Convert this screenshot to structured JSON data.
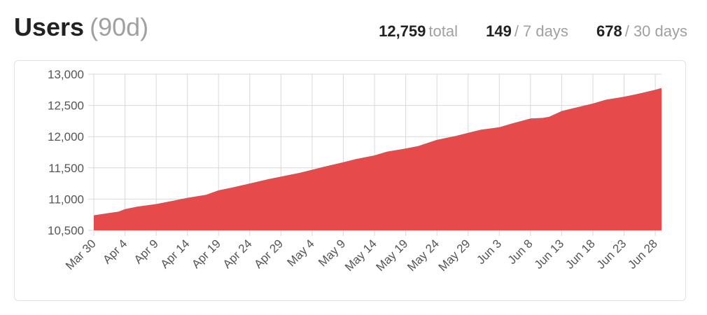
{
  "header": {
    "title": "Users",
    "period": "(90d)",
    "stats": [
      {
        "value": "12,759",
        "label": "total"
      },
      {
        "value": "149",
        "label": "/ 7 days"
      },
      {
        "value": "678",
        "label": "/ 30 days"
      }
    ]
  },
  "colors": {
    "area_fill": "#e64a4a",
    "grid": "#d9d9d9",
    "tick_text": "#555555"
  },
  "chart_data": {
    "type": "area",
    "title": "",
    "xlabel": "",
    "ylabel": "",
    "grid": true,
    "ylim": [
      10500,
      13000
    ],
    "y_ticks": [
      10500,
      11000,
      11500,
      12000,
      12500,
      13000
    ],
    "y_tick_labels": [
      "10,500",
      "11,000",
      "11,500",
      "12,000",
      "12,500",
      "13,000"
    ],
    "x_tick_labels": [
      "Mar 30",
      "Apr 4",
      "Apr 9",
      "Apr 14",
      "Apr 19",
      "Apr 24",
      "Apr 29",
      "May 4",
      "May 9",
      "May 14",
      "May 19",
      "May 24",
      "May 29",
      "Jun 3",
      "Jun 8",
      "Jun 13",
      "Jun 18",
      "Jun 23",
      "Jun 28"
    ],
    "x": [
      "Mar 30",
      "Apr 1",
      "Apr 3",
      "Apr 4",
      "Apr 6",
      "Apr 9",
      "Apr 12",
      "Apr 14",
      "Apr 17",
      "Apr 19",
      "Apr 21",
      "Apr 24",
      "Apr 27",
      "Apr 29",
      "May 2",
      "May 4",
      "May 6",
      "May 9",
      "May 11",
      "May 14",
      "May 16",
      "May 19",
      "May 21",
      "May 24",
      "May 27",
      "May 29",
      "May 31",
      "Jun 3",
      "Jun 5",
      "Jun 8",
      "Jun 10",
      "Jun 11",
      "Jun 13",
      "Jun 15",
      "Jun 18",
      "Jun 20",
      "Jun 23",
      "Jun 25",
      "Jun 28",
      "Jun 29"
    ],
    "series": [
      {
        "values": [
          10740,
          10770,
          10800,
          10840,
          10880,
          10920,
          10980,
          11020,
          11070,
          11140,
          11180,
          11250,
          11320,
          11360,
          11420,
          11470,
          11520,
          11590,
          11640,
          11700,
          11760,
          11810,
          11850,
          11950,
          12010,
          12060,
          12110,
          12150,
          12210,
          12290,
          12300,
          12320,
          12410,
          12460,
          12530,
          12590,
          12640,
          12680,
          12750,
          12780
        ]
      }
    ]
  }
}
